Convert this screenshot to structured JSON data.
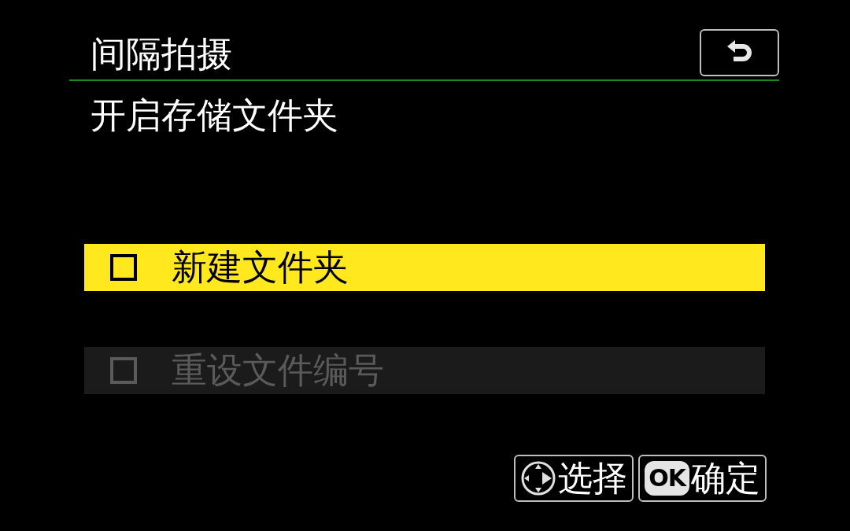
{
  "header": {
    "title": "间隔拍摄"
  },
  "subtitle": "开启存储文件夹",
  "options": [
    {
      "label": "新建文件夹",
      "checked": false,
      "selected": true,
      "disabled": false
    },
    {
      "label": "重设文件编号",
      "checked": false,
      "selected": false,
      "disabled": true
    }
  ],
  "hints": [
    {
      "kind": "dpad",
      "label": "选择"
    },
    {
      "kind": "ok",
      "key": "OK",
      "label": "确定"
    }
  ]
}
